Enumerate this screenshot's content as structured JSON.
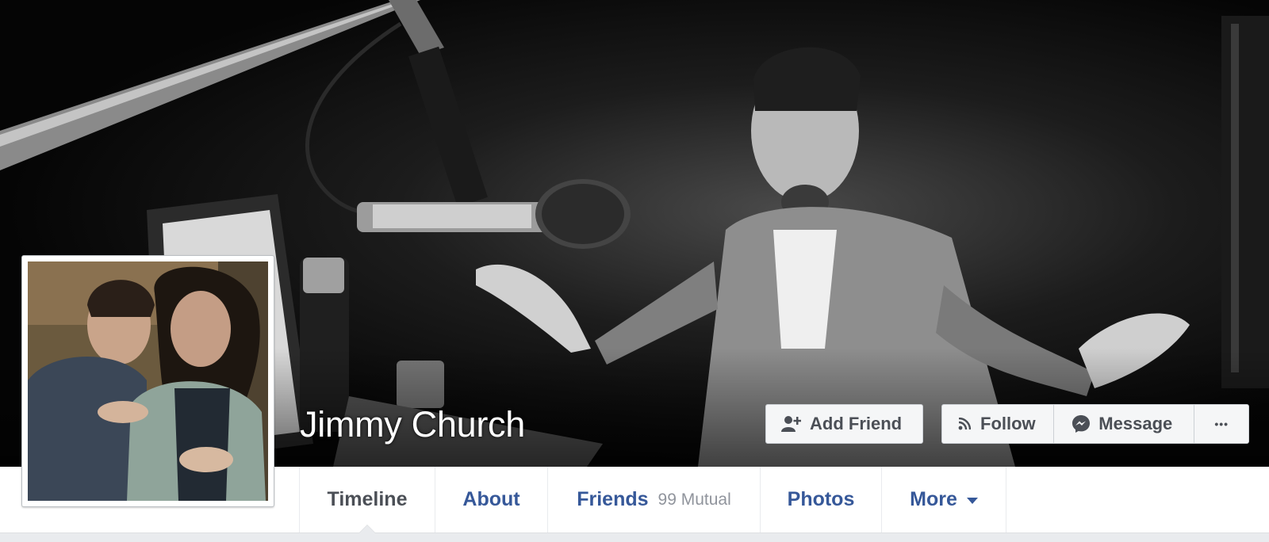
{
  "profile": {
    "name": "Jimmy Church"
  },
  "actions": {
    "add_friend": "Add Friend",
    "follow": "Follow",
    "message": "Message",
    "more_dots": "•••"
  },
  "icons": {
    "add_friend": "add-friend-icon",
    "follow": "rss-follow-icon",
    "message": "messenger-icon",
    "more": "ellipsis-icon",
    "more_caret": "caret-down-icon"
  },
  "tabs": [
    {
      "label": "Timeline",
      "active": true
    },
    {
      "label": "About"
    },
    {
      "label": "Friends",
      "sub": "99 Mutual"
    },
    {
      "label": "Photos"
    },
    {
      "label": "More"
    }
  ],
  "colors": {
    "link_blue": "#365899",
    "active_gray": "#4b4f56",
    "muted": "#90949c",
    "button_bg": "#f5f6f7",
    "border": "#ccd0d5",
    "page_bg": "#e9ebee"
  }
}
